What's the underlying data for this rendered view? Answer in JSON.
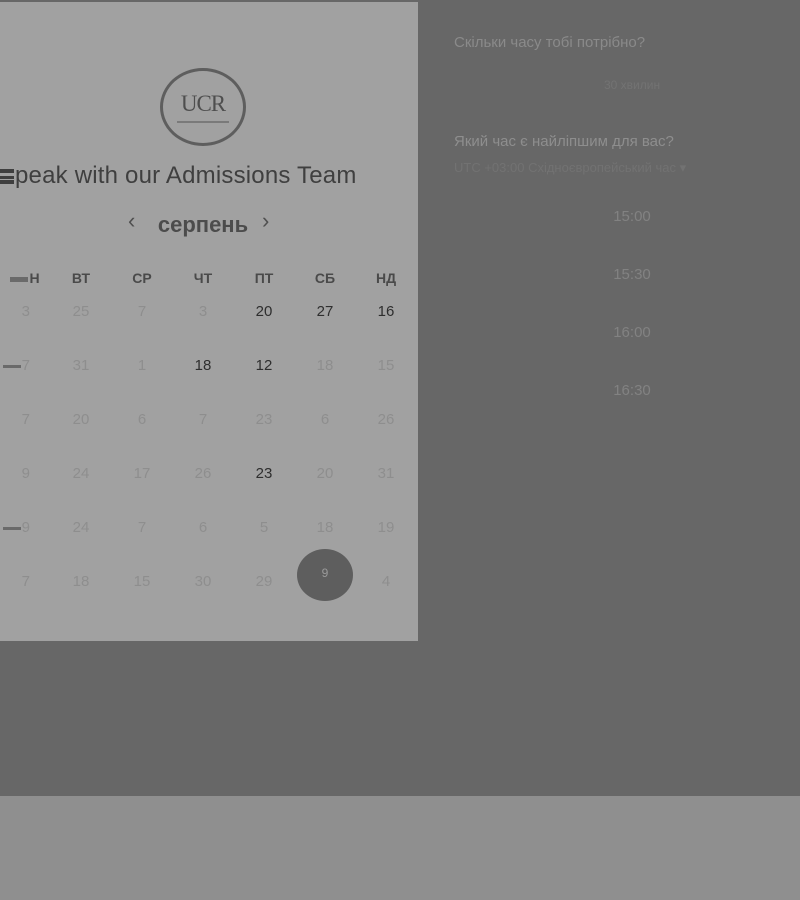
{
  "booking": {
    "logo_text": "UCR",
    "title_rest": "peak with our Admissions Team",
    "month": "серпень",
    "prev_icon": "chevron-left-icon",
    "next_icon": "chevron-right-icon"
  },
  "weekdays": [
    "Н",
    "ВТ",
    "СР",
    "ЧТ",
    "ПТ",
    "СБ",
    "НД"
  ],
  "weeks": [
    [
      "3",
      "25",
      "7",
      "3",
      "20",
      "27",
      "16"
    ],
    [
      "7",
      "31",
      "1",
      "18",
      "12",
      "18",
      "15"
    ],
    [
      "7",
      "20",
      "6",
      "7",
      "23",
      "6",
      "26"
    ],
    [
      "9",
      "24",
      "17",
      "26",
      "23",
      "20",
      "31"
    ],
    [
      "9",
      "24",
      "7",
      "6",
      "5",
      "18",
      "19"
    ],
    [
      "7",
      "18",
      "15",
      "30",
      "29",
      "9",
      "4"
    ]
  ],
  "available_days": [
    "0-4",
    "0-5",
    "0-6",
    "1-3",
    "1-4",
    "3-4"
  ],
  "selected_day": "5-5",
  "details": {
    "duration_question": "Скільки часу тобі потрібно?",
    "duration_value": "30 хвилин",
    "time_question": "Який час є найліпшим для вас?",
    "timezone": "UTC +03:00 Східноєвропейський час ▾"
  },
  "time_slots": [
    "15:00",
    "15:30",
    "16:00",
    "16:30"
  ],
  "colors": {
    "overlay": "#676767",
    "card": "#a1a1a1",
    "footer": "#8f8f8f",
    "selected_day": "#5e5e5e"
  }
}
